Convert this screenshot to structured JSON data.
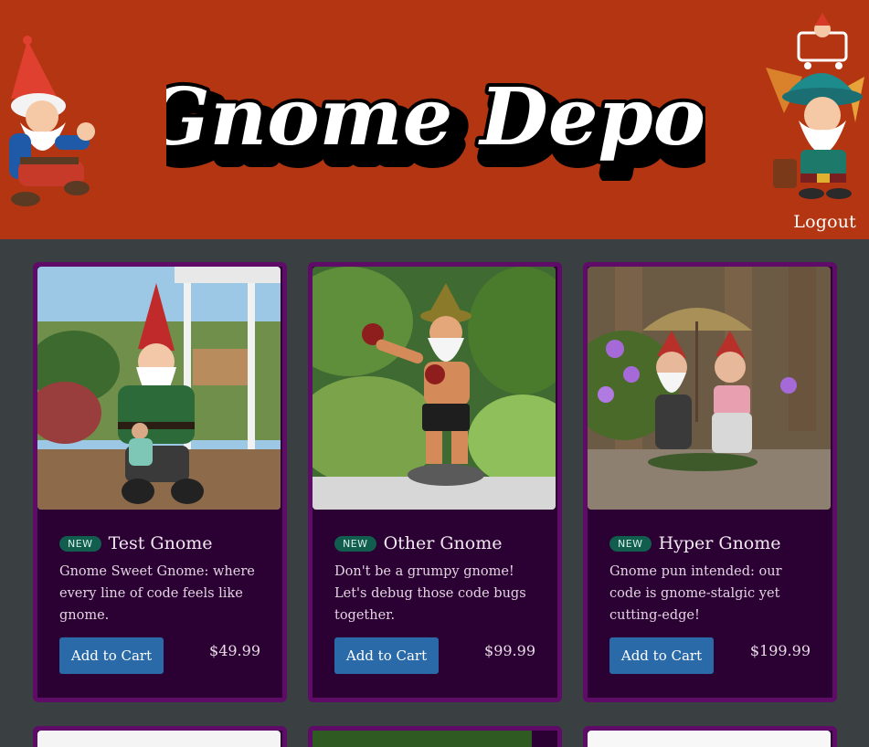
{
  "header": {
    "logo_text": "Gnome Depot",
    "logout_label": "Logout"
  },
  "products": [
    {
      "badge": "NEW",
      "title": "Test Gnome",
      "description": "Gnome Sweet Gnome: where every line of code feels like gnome.",
      "button_label": "Add to Cart",
      "price": "$49.99",
      "image": "gnome-statue-with-girl-photo"
    },
    {
      "badge": "NEW",
      "title": "Other Gnome",
      "description": "Don't be a grumpy gnome! Let's debug those code bugs together.",
      "button_label": "Add to Cart",
      "price": "$99.99",
      "image": "boxing-gnome-photo"
    },
    {
      "badge": "NEW",
      "title": "Hyper Gnome",
      "description": "Gnome pun intended: our code is gnome-stalgic yet cutting-edge!",
      "button_label": "Add to Cart",
      "price": "$199.99",
      "image": "gnome-couple-umbrella-photo"
    }
  ],
  "colors": {
    "header_bg": "#b43512",
    "page_bg": "#3a3f41",
    "card_bg": "#2b0032",
    "card_border": "#5e0c68",
    "button": "#2b6aa8",
    "badge": "#115e4f"
  }
}
